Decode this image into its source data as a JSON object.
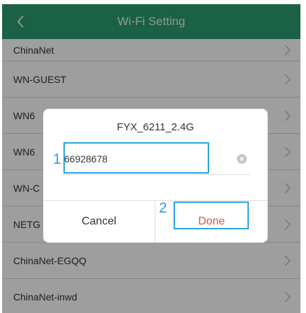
{
  "header": {
    "title": "Wi-Fi Setting",
    "back_icon": "chevron-left-icon"
  },
  "networks": [
    {
      "ssid": "ChinaNet"
    },
    {
      "ssid": "WN-GUEST"
    },
    {
      "ssid": "WN6"
    },
    {
      "ssid": "WN6"
    },
    {
      "ssid": "WN-C"
    },
    {
      "ssid": "NETG"
    },
    {
      "ssid": "ChinaNet-EGQQ"
    },
    {
      "ssid": "ChinaNet-inwd"
    }
  ],
  "dialog": {
    "title": "FYX_6211_2.4G",
    "password_value": "66928678",
    "cancel_label": "Cancel",
    "done_label": "Done"
  },
  "callouts": {
    "step1": "1",
    "step2": "2"
  },
  "colors": {
    "header": "#2a9d72",
    "accent_done": "#e8503a",
    "callout": "#29a3e4"
  }
}
